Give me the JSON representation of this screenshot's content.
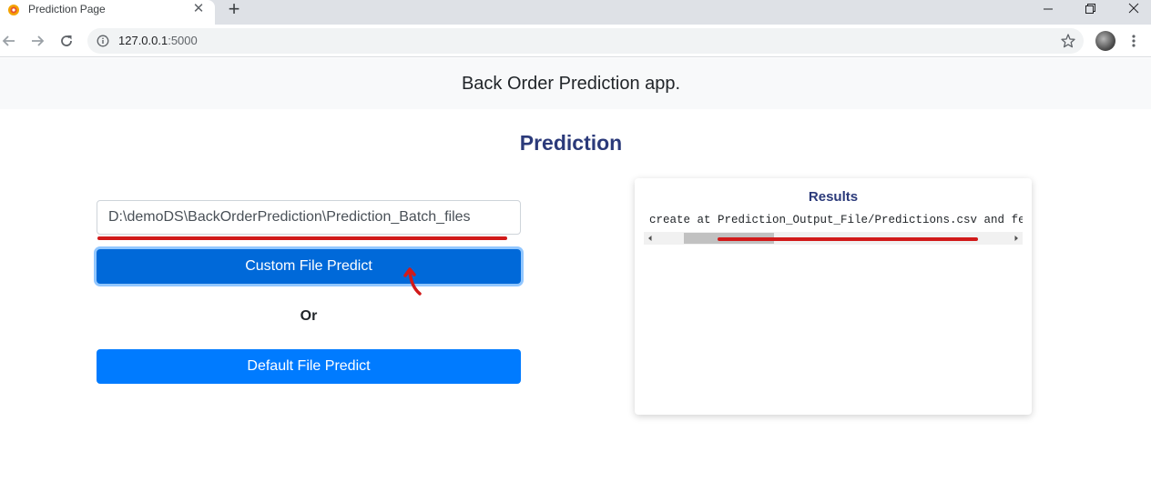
{
  "browser": {
    "tab_title": "Prediction Page",
    "new_tab_label": "+",
    "tab_close_label": "✕",
    "url_host": "127.0.0.1",
    "url_rest": ":5000"
  },
  "navbar": {
    "brand": "Back Order Prediction app."
  },
  "page": {
    "title": "Prediction"
  },
  "form": {
    "path_value": "D:\\demoDS\\BackOrderPrediction\\Prediction_Batch_files",
    "custom_button": "Custom File Predict",
    "or_label": "Or",
    "default_button": "Default File Predict"
  },
  "results": {
    "title": "Results",
    "text": "create at Prediction_Output_File/Predictions.csv and few of the predictions are"
  },
  "colors": {
    "primary": "#007bff",
    "primary_active": "#0069d9",
    "title_navy": "#2b3a7a",
    "annotation_red": "#d11a1a"
  }
}
